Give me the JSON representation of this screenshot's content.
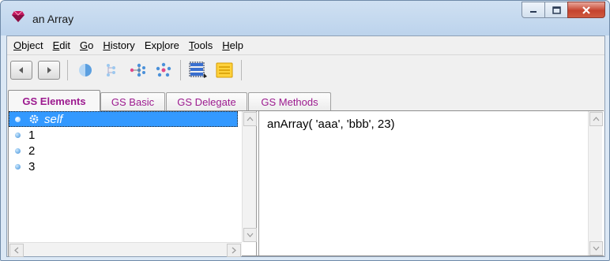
{
  "window": {
    "title": "an Array"
  },
  "menu": [
    {
      "mnemonic": "O",
      "rest": "bject"
    },
    {
      "mnemonic": "E",
      "rest": "dit"
    },
    {
      "mnemonic": "G",
      "rest": "o"
    },
    {
      "mnemonic": "H",
      "rest": "istory"
    },
    {
      "prefix": "Exp",
      "mnemonic": "l",
      "rest": "ore"
    },
    {
      "mnemonic": "T",
      "rest": "ools"
    },
    {
      "mnemonic": "H",
      "rest": "elp"
    }
  ],
  "tabs": [
    {
      "label": "GS Elements",
      "active": true
    },
    {
      "label": "GS Basic",
      "active": false
    },
    {
      "label": "GS Delegate",
      "active": false
    },
    {
      "label": "GS Methods",
      "active": false
    }
  ],
  "elements": [
    {
      "label": "self",
      "selected": true
    },
    {
      "label": "1",
      "selected": false
    },
    {
      "label": "2",
      "selected": false
    },
    {
      "label": "3",
      "selected": false
    }
  ],
  "value_text": "anArray( 'aaa', 'bbb', 23)",
  "colors": {
    "accent_tab_text": "#9c1a8f",
    "selection": "#3399ff",
    "close_button": "#c5432e"
  }
}
